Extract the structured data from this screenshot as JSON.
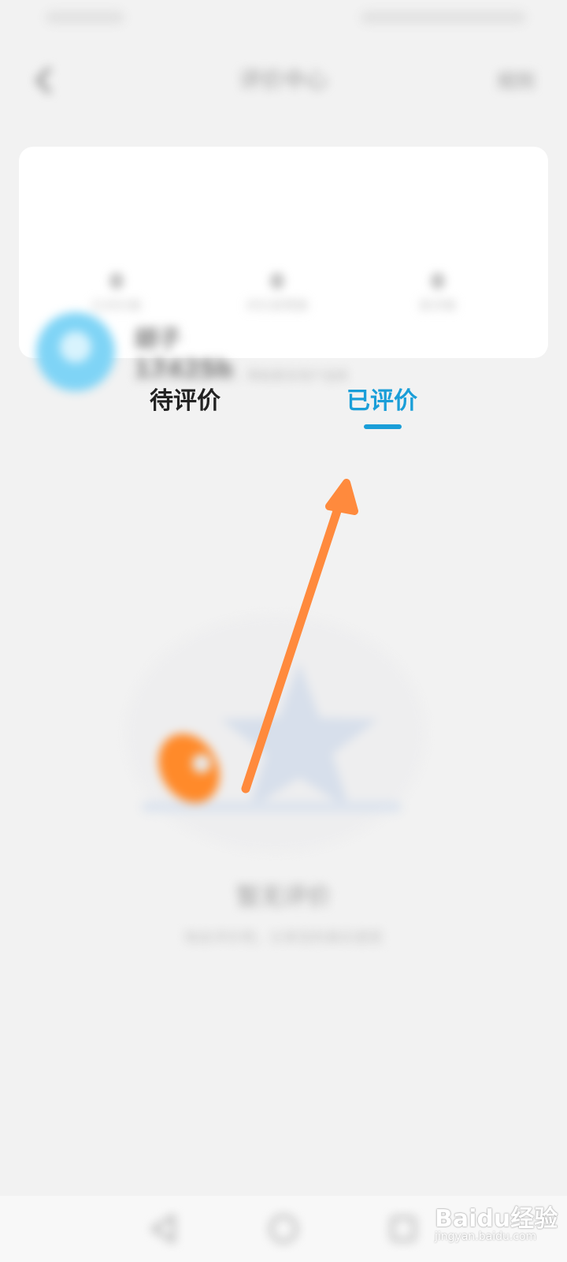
{
  "header": {
    "title": "评价中心",
    "action_label": "规则"
  },
  "profile": {
    "username": "胡子17425b",
    "description": "分享您的真实评价，帮助更多用户选择",
    "stats": [
      {
        "value": "0",
        "label": "已评价数"
      },
      {
        "value": "0",
        "label": "评价获赞数"
      },
      {
        "value": "0",
        "label": "获评数"
      }
    ]
  },
  "tabs": [
    {
      "label": "待评价",
      "active": false
    },
    {
      "label": "已评价",
      "active": true
    }
  ],
  "empty_state": {
    "title": "暂无评价",
    "description": "快去评价吧，分享您的真实感受"
  },
  "watermark": {
    "brand": "Baidu经验",
    "url": "jingyan.baidu.com"
  },
  "colors": {
    "accent": "#1a9ed8",
    "arrow": "#ff8a3d",
    "background": "#f2f2f2",
    "avatar": "#7fd4f6"
  },
  "icons": {
    "back": "back-arrow-icon",
    "nav_back": "triangle-back-icon",
    "nav_home": "circle-home-icon",
    "nav_recent": "square-recent-icon"
  }
}
